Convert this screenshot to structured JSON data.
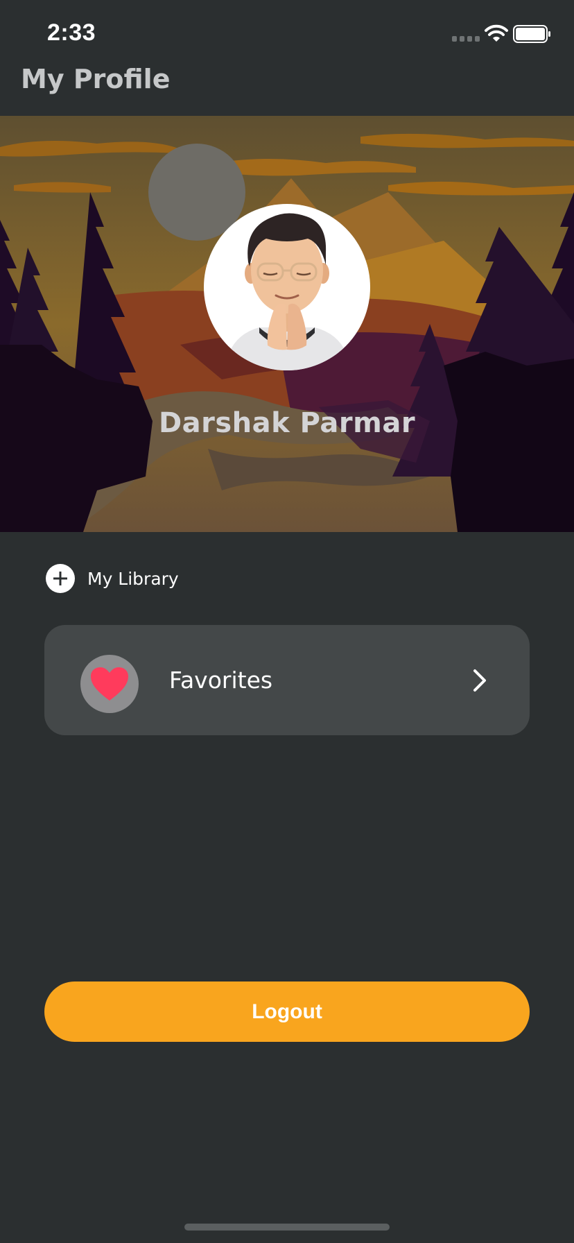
{
  "status_bar": {
    "time": "2:33",
    "icons": [
      "cellular-signal-icon",
      "wifi-icon",
      "battery-icon"
    ]
  },
  "header": {
    "title": "My Profile"
  },
  "profile": {
    "name": "Darshak Parmar",
    "avatar_icon": "memoji-avatar-icon"
  },
  "library": {
    "label": "My Library",
    "icon": "plus-circle-icon"
  },
  "favorites": {
    "label": "Favorites",
    "icon": "heart-icon",
    "chevron": "chevron-right-icon"
  },
  "logout": {
    "label": "Logout"
  },
  "colors": {
    "background": "#2b2f30",
    "card": "#444849",
    "accent": "#f9a51e",
    "heart": "#ff3b5c"
  }
}
